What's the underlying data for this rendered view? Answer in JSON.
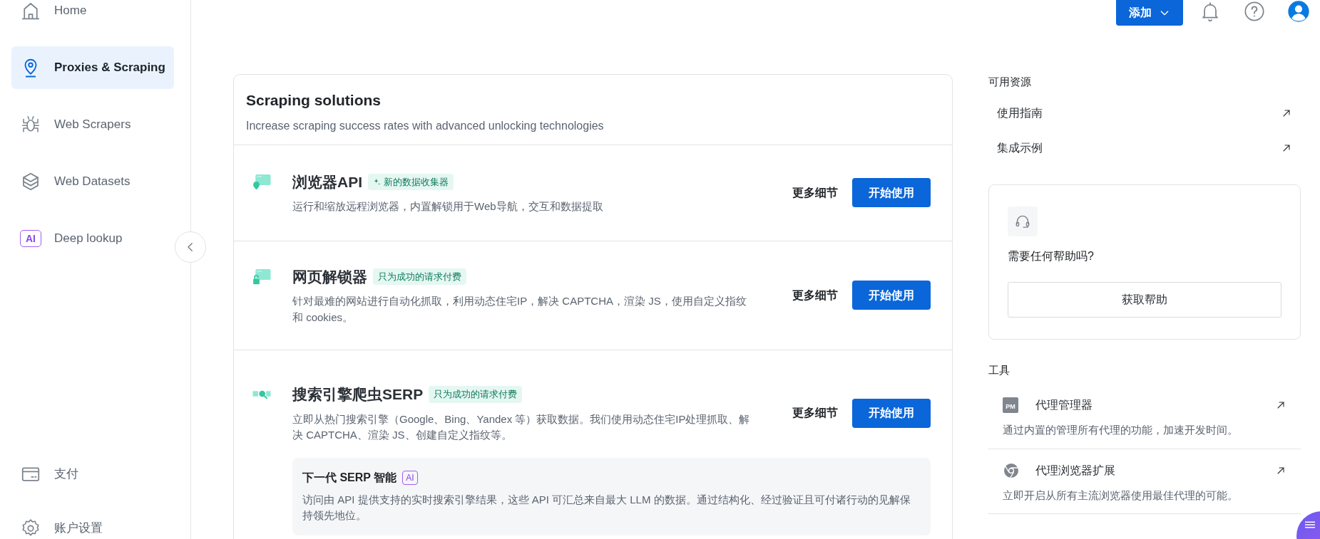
{
  "sidebar": {
    "items": [
      {
        "label": "Home",
        "selected": false
      },
      {
        "label": "Proxies & Scraping",
        "selected": true
      },
      {
        "label": "Web Scrapers",
        "selected": false
      },
      {
        "label": "Web Datasets",
        "selected": false
      },
      {
        "label": "Deep lookup",
        "selected": false,
        "badge": "AI"
      }
    ],
    "bottom_items": [
      {
        "label": "支付",
        "selected": false
      },
      {
        "label": "账户设置",
        "selected": false
      }
    ]
  },
  "header": {
    "add_button": "添加"
  },
  "solutions": {
    "title": "Scraping solutions",
    "subtitle": "Increase scraping success rates with advanced unlocking technologies",
    "rows": [
      {
        "title": "浏览器API",
        "tag": "新的数据收集器",
        "tag_sparkle": true,
        "description": "运行和缩放远程浏览器，内置解锁用于Web导航，交互和数据提取",
        "details": "更多细节",
        "start": "开始使用"
      },
      {
        "title": "网页解锁器",
        "tag": "只为成功的请求付费",
        "tag_sparkle": false,
        "description": "针对最难的网站进行自动化抓取，利用动态住宅IP，解决 CAPTCHA，渲染 JS，使用自定义指纹和 cookies。",
        "details": "更多细节",
        "start": "开始使用"
      },
      {
        "title": "搜索引擎爬虫SERP",
        "tag": "只为成功的请求付费",
        "tag_sparkle": false,
        "description": "立即从热门搜索引擎（Google、Bing、Yandex 等）获取数据。我们使用动态住宅IP处理抓取、解决 CAPTCHA、渲染 JS、创建自定义指纹等。",
        "details": "更多细节",
        "start": "开始使用",
        "promo": {
          "title": "下一代 SERP 智能",
          "badge": "AI",
          "description": "访问由 API 提供支持的实时搜索引擎结果，这些 API 可汇总来自最大 LLM 的数据。通过结构化、经过验证且可付诸行动的见解保持领先地位。"
        }
      }
    ]
  },
  "resources": {
    "title": "可用资源",
    "links": [
      "使用指南",
      "集成示例"
    ]
  },
  "help": {
    "question": "需要任何帮助吗?",
    "button": "获取帮助"
  },
  "tools": {
    "title": "工具",
    "items": [
      {
        "name": "代理管理器",
        "icon_label": "PM",
        "description": "通过内置的管理所有代理的功能，加速开发时间。"
      },
      {
        "name": "代理浏览器扩展",
        "description": "立即开启从所有主流浏览器使用最佳代理的可能。"
      }
    ]
  }
}
